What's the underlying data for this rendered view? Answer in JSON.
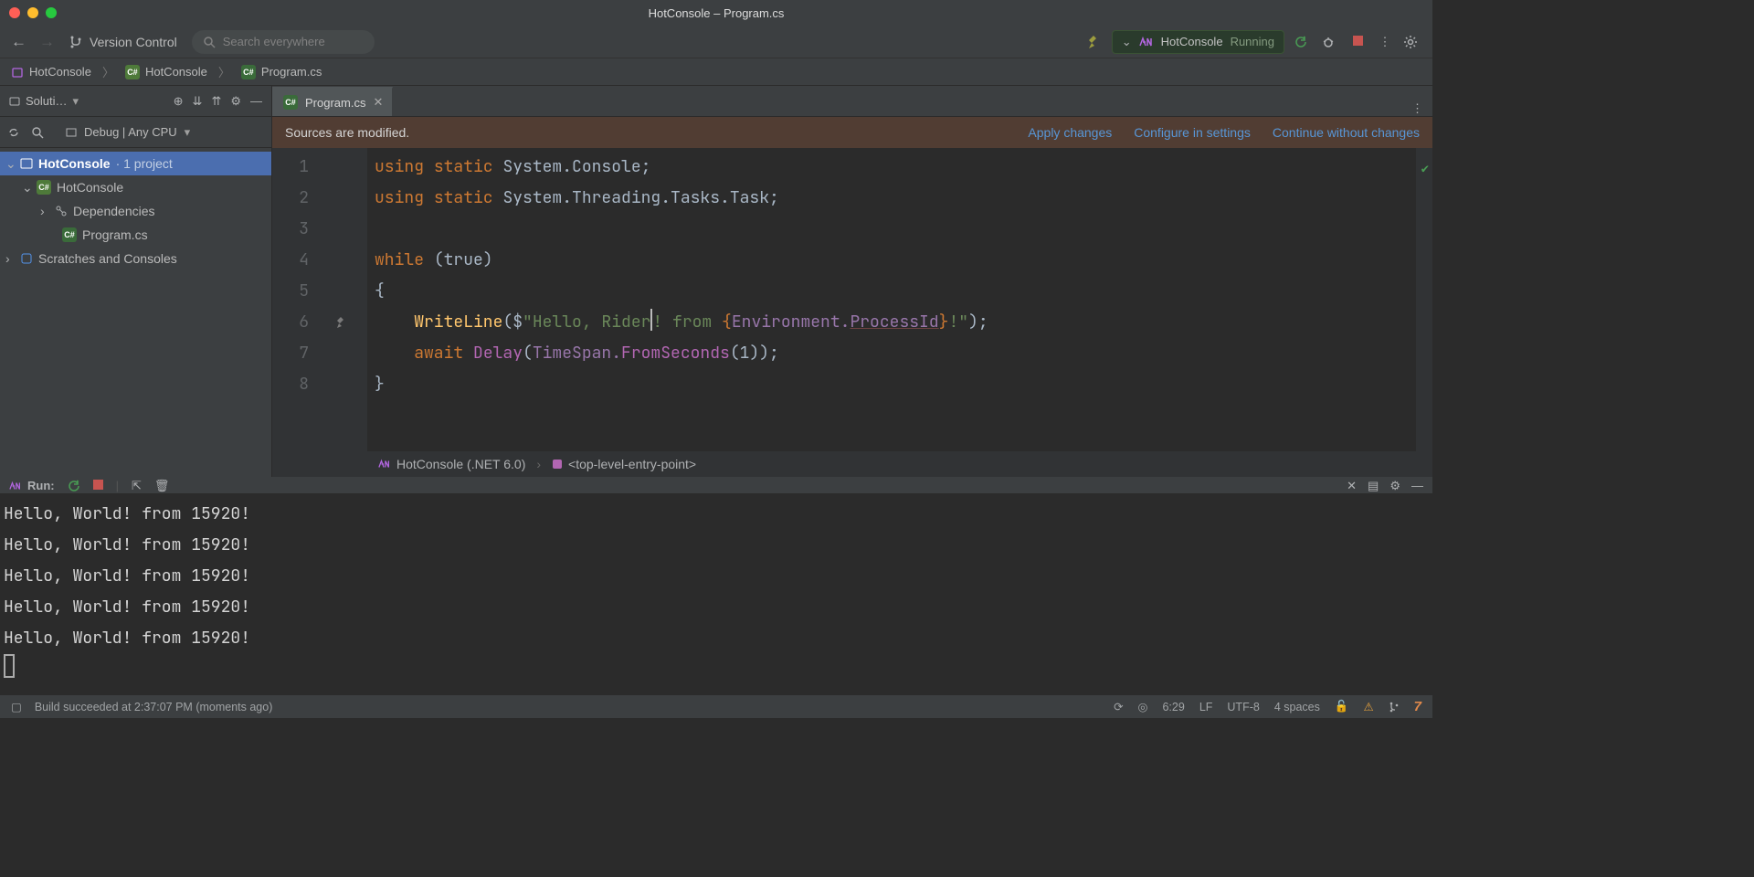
{
  "window": {
    "title": "HotConsole – Program.cs"
  },
  "toolbar": {
    "vcs": "Version Control",
    "search_placeholder": "Search everywhere",
    "run_config": "HotConsole",
    "run_status": "Running"
  },
  "breadcrumb": {
    "items": [
      "HotConsole",
      "HotConsole",
      "Program.cs"
    ]
  },
  "sidebar": {
    "title": "Soluti…",
    "config": "Debug | Any CPU",
    "tree": {
      "root": "HotConsole",
      "root_suffix": " · 1 project",
      "proj": "HotConsole",
      "dep": "Dependencies",
      "file": "Program.cs",
      "scratches": "Scratches and Consoles"
    }
  },
  "tabs": {
    "active": "Program.cs"
  },
  "notif": {
    "msg": "Sources are modified.",
    "apply": "Apply changes",
    "configure": "Configure in settings",
    "continue": "Continue without changes"
  },
  "code": {
    "lines": [
      "1",
      "2",
      "3",
      "4",
      "5",
      "6",
      "7",
      "8"
    ],
    "l1": {
      "k1": "using",
      "k2": "static",
      "ns": "System.Console;"
    },
    "l2": {
      "k1": "using",
      "k2": "static",
      "ns": "System.Threading.Tasks.Task;"
    },
    "l4": {
      "k1": "while",
      "cond": "(true)"
    },
    "l5": "{",
    "l6": {
      "fn": "WriteLine",
      "open": "($",
      "s1": "\"Hello, Rider",
      "s2": "! from ",
      "lb": "{",
      "env": "Environment.",
      "pid": "ProcessId",
      "rb": "}",
      "s3": "!\"",
      "close": ");"
    },
    "l7": {
      "k1": "await",
      "fn": "Delay",
      "open": "(",
      "ts": "TimeSpan.",
      "fsec": "FromSeconds",
      "arg": "(1));"
    },
    "l8": "}"
  },
  "crumbs": {
    "proj": "HotConsole (.NET 6.0)",
    "entry": "<top-level-entry-point>"
  },
  "run": {
    "label": "Run:",
    "output": [
      "Hello, World! from 15920!",
      "Hello, World! from 15920!",
      "Hello, World! from 15920!",
      "Hello, World! from 15920!",
      "Hello, World! from 15920!"
    ]
  },
  "status": {
    "build": "Build succeeded at 2:37:07 PM  (moments ago)",
    "pos": "6:29",
    "eol": "LF",
    "charset": "UTF-8",
    "indent": "4 spaces"
  }
}
